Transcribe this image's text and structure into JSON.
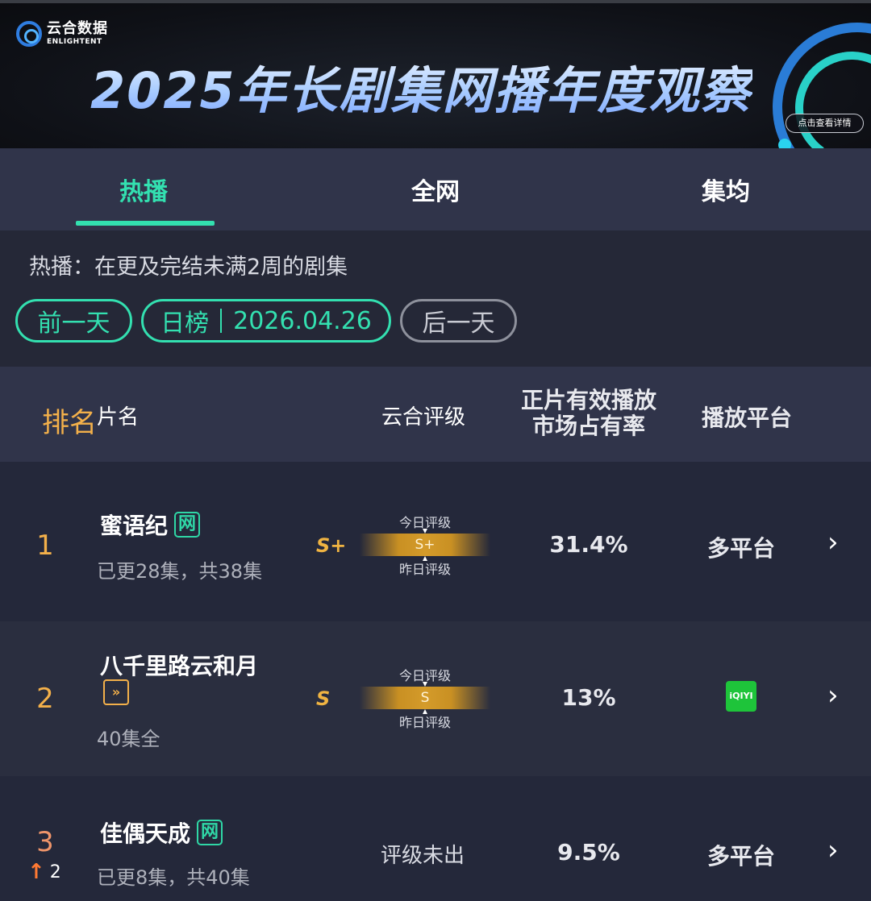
{
  "brand": {
    "name_cn": "云合数据",
    "name_en": "ENLIGHTENT"
  },
  "banner": {
    "title": "2025年长剧集网播年度观察",
    "detail_label": "点击查看详情"
  },
  "tabs": [
    {
      "label": "热播",
      "active": true
    },
    {
      "label": "全网",
      "active": false
    },
    {
      "label": "集均",
      "active": false
    }
  ],
  "description": "热播：在更及完结未满2周的剧集",
  "date_nav": {
    "prev_label": "前一天",
    "board_label": "日榜",
    "date": "2026.04.26",
    "next_label": "后一天"
  },
  "table": {
    "headers": {
      "rank": "排名",
      "name": "片名",
      "grade": "云合评级",
      "share": "正片有效播放\n市场占有率",
      "platform": "播放平台"
    },
    "rows": [
      {
        "rank": "1",
        "title": "蜜语纪",
        "tag": "网",
        "subtitle": "已更28集，共38集",
        "grade_letter": "S+",
        "grade_today_label": "今日评级",
        "grade_value": "S+",
        "grade_yesterday_label": "昨日评级",
        "share": "31.4%",
        "platform": "多平台"
      },
      {
        "rank": "2",
        "title": "八千里路云和月",
        "tag_icon": "fast-forward-icon",
        "subtitle": "40集全",
        "grade_letter": "S",
        "grade_today_label": "今日评级",
        "grade_value": "S",
        "grade_yesterday_label": "昨日评级",
        "share": "13%",
        "platform_logo": "iQIYI"
      },
      {
        "rank": "3",
        "rank_change": "2",
        "title": "佳偶天成",
        "tag": "网",
        "subtitle": "已更8集，共40集",
        "grade_status": "评级未出",
        "share": "9.5%",
        "platform": "多平台"
      }
    ]
  },
  "colors": {
    "accent": "#33e0b0",
    "gold": "#f3b04a",
    "up_arrow": "#ff7a33",
    "iqiyi_green": "#1ec43a"
  }
}
